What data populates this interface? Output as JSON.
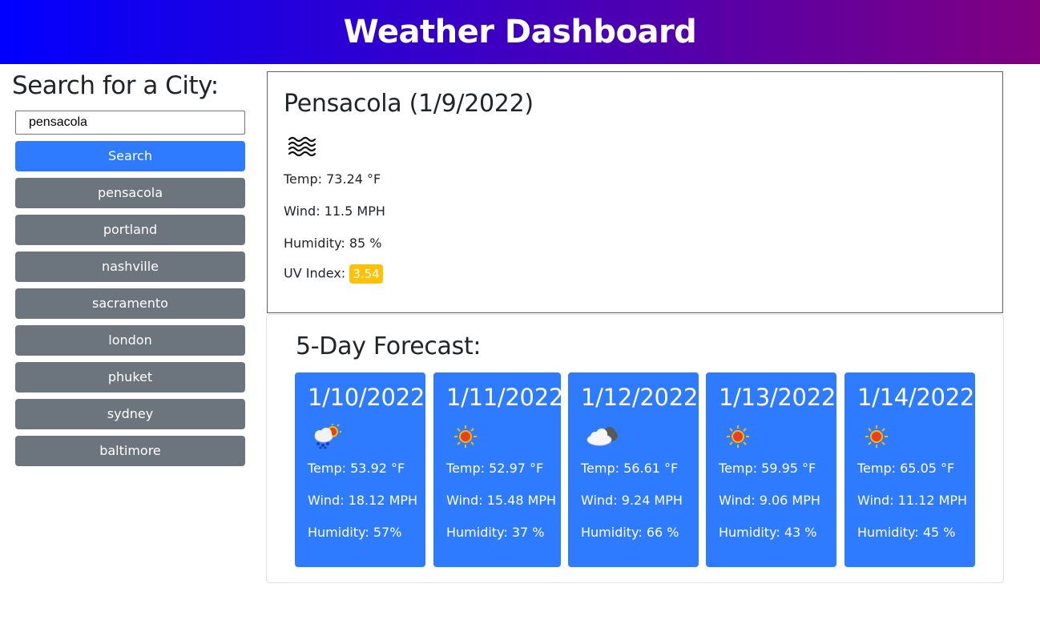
{
  "header": {
    "title": "Weather Dashboard"
  },
  "search": {
    "heading": "Search for a City:",
    "input_value": "pensacola",
    "button_label": "Search",
    "history": [
      "pensacola",
      "portland",
      "nashville",
      "sacramento",
      "london",
      "phuket",
      "sydney",
      "baltimore"
    ]
  },
  "current": {
    "title": "Pensacola (1/9/2022)",
    "icon": "mist-icon",
    "temp": "Temp: 73.24 °F",
    "wind": "Wind: 11.5 MPH",
    "humidity": "Humidity: 85 %",
    "uv_label": "UV Index:",
    "uv_value": "3.54",
    "uv_color": "#ffc107"
  },
  "forecast": {
    "heading": "5-Day Forecast:",
    "card_color": "#2f7bff",
    "days": [
      {
        "date": "1/10/2022",
        "icon": "rain-sun-icon",
        "temp": "Temp: 53.92 °F",
        "wind": "Wind: 18.12 MPH",
        "humidity": "Humidity: 57%"
      },
      {
        "date": "1/11/2022",
        "icon": "sun-icon",
        "temp": "Temp: 52.97 °F",
        "wind": "Wind: 15.48 MPH",
        "humidity": "Humidity: 37 %"
      },
      {
        "date": "1/12/2022",
        "icon": "cloud-icon",
        "temp": "Temp: 56.61 °F",
        "wind": "Wind: 9.24 MPH",
        "humidity": "Humidity: 66 %"
      },
      {
        "date": "1/13/2022",
        "icon": "sun-icon",
        "temp": "Temp: 59.95 °F",
        "wind": "Wind: 9.06 MPH",
        "humidity": "Humidity: 43 %"
      },
      {
        "date": "1/14/2022",
        "icon": "sun-icon",
        "temp": "Temp: 65.05 °F",
        "wind": "Wind: 11.12 MPH",
        "humidity": "Humidity: 45 %"
      }
    ]
  }
}
